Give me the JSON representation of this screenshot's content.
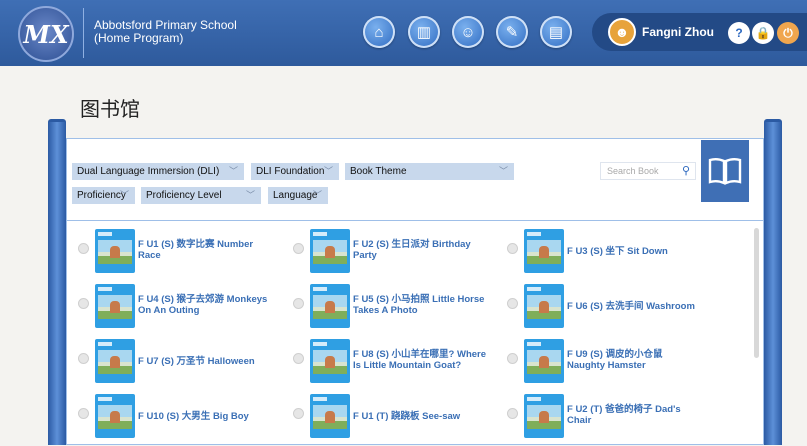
{
  "header": {
    "logo_text": "MX",
    "school_line1": "Abbotsford Primary School",
    "school_line2": "(Home Program)",
    "nav": [
      {
        "name": "home-icon",
        "glyph": "⌂"
      },
      {
        "name": "books-icon",
        "glyph": "▥"
      },
      {
        "name": "students-icon",
        "glyph": "☺"
      },
      {
        "name": "notes-icon",
        "glyph": "✎"
      },
      {
        "name": "reports-icon",
        "glyph": "▤"
      }
    ],
    "user_name": "Fangni Zhou",
    "help": "?",
    "lock": "🔒",
    "power": "⏻"
  },
  "page": {
    "title": "图书馆"
  },
  "filters": {
    "program": "Dual Language Immersion (DLI)",
    "level": "DLI Foundation",
    "theme": "Book Theme",
    "proficiency": "Proficiency",
    "proficiency_level": "Proficiency Level",
    "language": "Language",
    "search_placeholder": "Search Book"
  },
  "books": [
    {
      "line1": "F U1 (S) 数字比赛 Number",
      "line2": "Race"
    },
    {
      "line1": "F U2 (S) 生日派对 Birthday",
      "line2": "Party"
    },
    {
      "line1": "F U3 (S) 坐下 Sit Down",
      "line2": ""
    },
    {
      "line1": "F U4 (S) 猴子去郊游 Monkeys",
      "line2": "On An Outing"
    },
    {
      "line1": "F U5 (S) 小马拍照 Little Horse",
      "line2": "Takes A Photo"
    },
    {
      "line1": "F U6 (S) 去洗手间 Washroom",
      "line2": ""
    },
    {
      "line1": "F U7 (S) 万圣节 Halloween",
      "line2": ""
    },
    {
      "line1": "F U8 (S) 小山羊在哪里? Where",
      "line2": "Is Little Mountain Goat?"
    },
    {
      "line1": "F U9 (S) 调皮的小仓鼠",
      "line2": "Naughty Hamster"
    },
    {
      "line1": "F U10 (S) 大男生 Big Boy",
      "line2": ""
    },
    {
      "line1": "F U1 (T) 跷跷板 See-saw",
      "line2": ""
    },
    {
      "line1": "F U2 (T) 爸爸的椅子 Dad's",
      "line2": "Chair"
    }
  ]
}
